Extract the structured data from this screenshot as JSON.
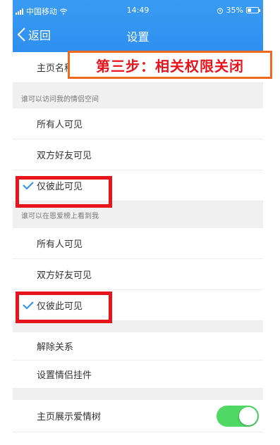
{
  "status_bar": {
    "carrier": "中国移动",
    "time": "14:49",
    "battery": "35%",
    "battery_level": 0.35
  },
  "nav": {
    "back_label": "返回",
    "title": "设置"
  },
  "overlay_annotation": "第三步：相关权限关闭",
  "rows": {
    "homepage_name_label": "主页名称"
  },
  "section_space": {
    "header": "谁可以访问我的情侣空间",
    "options": [
      "所有人可见",
      "双方好友可见",
      "仅彼此可见"
    ],
    "selected": 2
  },
  "section_ranking": {
    "header": "谁可以在恩爱榜上看到我",
    "options": [
      "所有人可见",
      "双方好友可见",
      "仅彼此可见"
    ],
    "selected": 2
  },
  "actions": {
    "unbind": "解除关系",
    "pendant": "设置情侣挂件"
  },
  "love_tree": {
    "label": "主页展示爱情树",
    "enabled": true
  },
  "colors": {
    "header_blue": "#2f8ff0",
    "highlight_red": "#e8141c",
    "overlay_orange": "#ef6a1e",
    "toggle_green": "#4fd964"
  }
}
